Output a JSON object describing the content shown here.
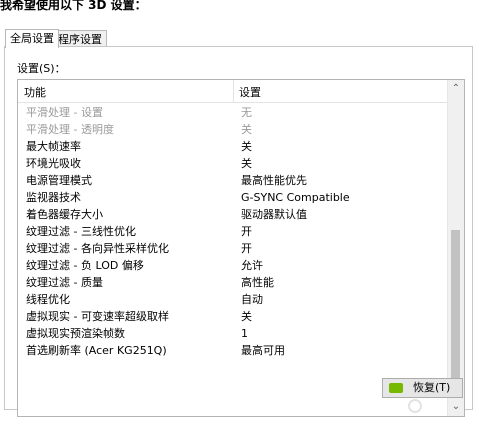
{
  "header": {
    "title": "我希望使用以下 3D 设置："
  },
  "tabs": [
    {
      "label": "全局设置",
      "active": true
    },
    {
      "label": "程序设置",
      "active": false
    }
  ],
  "panel": {
    "settings_label": "设置(S)："
  },
  "table": {
    "columns": [
      "功能",
      "设置"
    ],
    "rows": [
      {
        "feature": "平滑处理 - 设置",
        "value": "无",
        "disabled": true
      },
      {
        "feature": "平滑处理 - 透明度",
        "value": "关",
        "disabled": true
      },
      {
        "feature": "最大帧速率",
        "value": "关",
        "disabled": false
      },
      {
        "feature": "环境光吸收",
        "value": "关",
        "disabled": false
      },
      {
        "feature": "电源管理模式",
        "value": "最高性能优先",
        "disabled": false
      },
      {
        "feature": "监视器技术",
        "value": "G-SYNC Compatible",
        "disabled": false
      },
      {
        "feature": "着色器缓存大小",
        "value": "驱动器默认值",
        "disabled": false
      },
      {
        "feature": "纹理过滤 - 三线性优化",
        "value": "开",
        "disabled": false
      },
      {
        "feature": "纹理过滤 - 各向异性采样优化",
        "value": "开",
        "disabled": false
      },
      {
        "feature": "纹理过滤 - 负 LOD 偏移",
        "value": "允许",
        "disabled": false
      },
      {
        "feature": "纹理过滤 - 质量",
        "value": "高性能",
        "disabled": false
      },
      {
        "feature": "线程优化",
        "value": "自动",
        "disabled": false
      },
      {
        "feature": "虚拟现实 - 可变速率超级取样",
        "value": "关",
        "disabled": false
      },
      {
        "feature": "虚拟现实预渲染帧数",
        "value": "1",
        "disabled": false
      },
      {
        "feature": "首选刷新率 (Acer KG251Q)",
        "value": "最高可用",
        "disabled": false
      }
    ]
  },
  "buttons": {
    "restore": "恢复(T)"
  },
  "icons": {
    "scroll_up": "chevron-up-icon",
    "scroll_down": "chevron-down-icon",
    "brand": "nvidia-icon"
  },
  "colors": {
    "brand_green": "#76b900",
    "disabled_text": "#9a9a9a"
  }
}
